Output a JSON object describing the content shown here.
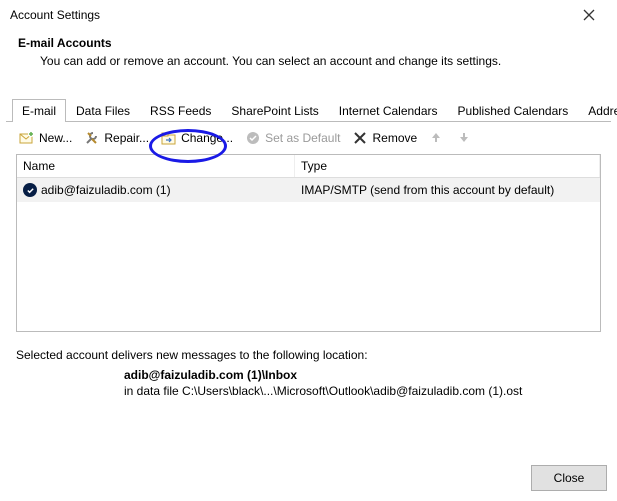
{
  "window": {
    "title": "Account Settings"
  },
  "header": {
    "title": "E-mail Accounts",
    "subtitle": "You can add or remove an account. You can select an account and change its settings."
  },
  "tabs": [
    {
      "label": "E-mail",
      "active": true
    },
    {
      "label": "Data Files"
    },
    {
      "label": "RSS Feeds"
    },
    {
      "label": "SharePoint Lists"
    },
    {
      "label": "Internet Calendars"
    },
    {
      "label": "Published Calendars"
    },
    {
      "label": "Address Books"
    }
  ],
  "toolbar": {
    "new": "New...",
    "repair": "Repair...",
    "change": "Change...",
    "default": "Set as Default",
    "remove": "Remove"
  },
  "grid": {
    "columns": {
      "name": "Name",
      "type": "Type"
    },
    "rows": [
      {
        "name": "adib@faizuladib.com (1)",
        "type": "IMAP/SMTP (send from this account by default)"
      }
    ]
  },
  "delivery": {
    "intro": "Selected account delivers new messages to the following location:",
    "loc1": "adib@faizuladib.com (1)\\Inbox",
    "loc2": "in data file C:\\Users\\black\\...\\Microsoft\\Outlook\\adib@faizuladib.com (1).ost"
  },
  "footer": {
    "close": "Close"
  }
}
